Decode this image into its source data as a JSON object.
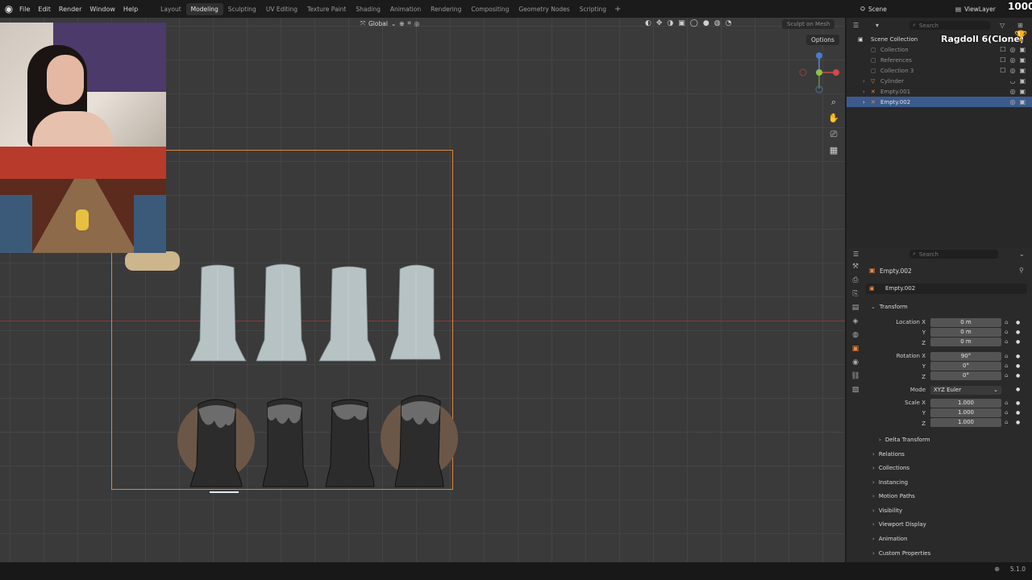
{
  "topbar": {
    "menus": [
      "File",
      "Edit",
      "Render",
      "Window",
      "Help"
    ],
    "workspaces": [
      "Layout",
      "Modeling",
      "Sculpting",
      "UV Editing",
      "Texture Paint",
      "Shading",
      "Animation",
      "Rendering",
      "Compositing",
      "Geometry Nodes",
      "Scripting"
    ],
    "active_workspace": "Modeling",
    "scene": "Scene",
    "view_layer": "ViewLayer",
    "score": "1000"
  },
  "viewport": {
    "orientation": "Global",
    "sculpt_button": "Sculpt on Mesh",
    "options": "Options"
  },
  "overlay": {
    "ragdoll_label": "Ragdoll 6(Clone)"
  },
  "outliner": {
    "search_placeholder": "Search",
    "root": "Scene Collection",
    "items": [
      {
        "name": "Collection"
      },
      {
        "name": "References"
      },
      {
        "name": "Collection 3"
      },
      {
        "name": "Cylinder"
      },
      {
        "name": "Empty.001"
      },
      {
        "name": "Empty.002"
      }
    ]
  },
  "properties": {
    "search_placeholder": "Search",
    "object_name": "Empty.002",
    "data_name": "Empty.002",
    "transform_label": "Transform",
    "location_label": "Location X",
    "rotation_label": "Rotation X",
    "scale_label": "Scale X",
    "y_label": "Y",
    "z_label": "Z",
    "location": [
      "0 m",
      "0 m",
      "0 m"
    ],
    "rotation": [
      "90°",
      "0°",
      "0°"
    ],
    "mode_label": "Mode",
    "mode_value": "XYZ Euler",
    "scale": [
      "1.000",
      "1.000",
      "1.000"
    ],
    "delta_transform": "Delta Transform",
    "sections": [
      "Relations",
      "Collections",
      "Instancing",
      "Motion Paths",
      "Visibility",
      "Viewport Display",
      "Animation",
      "Custom Properties"
    ]
  },
  "status": {
    "version": "5.1.0"
  },
  "colors": {
    "accent": "#3b5b8c",
    "selection_frame": "#d8893a",
    "active_tab": "#f0883a"
  }
}
